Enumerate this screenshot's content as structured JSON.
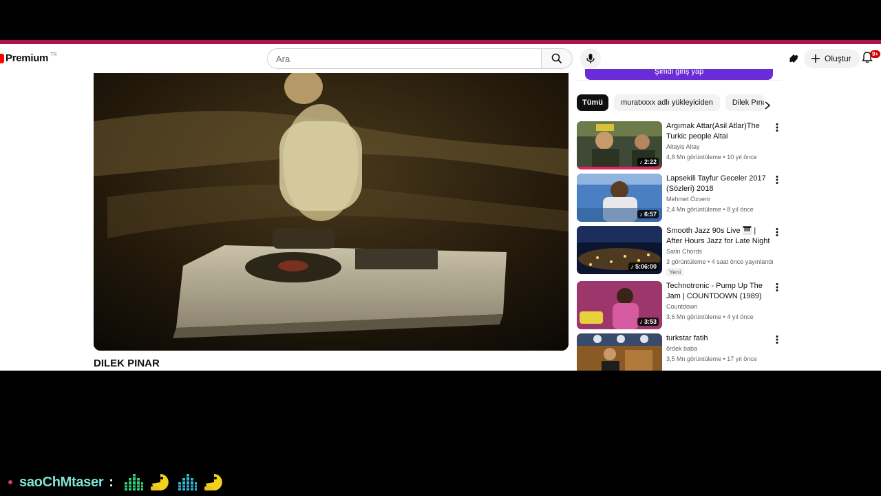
{
  "header": {
    "logo_text": "Premium",
    "logo_country": "TR",
    "search_placeholder": "Ara",
    "create_label": "Oluştur",
    "notif_count": "9+"
  },
  "video": {
    "title": "DILEK PINAR"
  },
  "sidebar": {
    "signin_button": "Şimdi giriş yap",
    "chips": [
      "Tümü",
      "muratxxxx adlı yükleyiciden",
      "Dilek Pınar"
    ],
    "recommendations": [
      {
        "title": "Argımak Attar(Asil Atlar)The Turkic people Altai",
        "channel": "Altayis Altay",
        "meta": "4,8 Mn görüntüleme • 10 yıl önce",
        "duration": "2:22",
        "is_new": false,
        "new_label": ""
      },
      {
        "title": "Lapsekili Tayfur Geceler 2017 (Sözleri) 2018",
        "channel": "Mehmet Özverir",
        "meta": "2,4 Mn görüntüleme • 8 yıl önce",
        "duration": "6:57",
        "is_new": false,
        "new_label": ""
      },
      {
        "title": "Smooth Jazz 90s Live 🎹 | After Hours Jazz for Late Night Foc...",
        "channel": "Satin Chords",
        "meta": "3 görüntüleme • 4 saat önce yayınlandı",
        "duration": "5:06:00",
        "is_new": true,
        "new_label": "Yeni"
      },
      {
        "title": "Technotronic - Pump Up The Jam | COUNTDOWN (1989)",
        "channel": "Countdown",
        "meta": "3,6 Mn görüntüleme • 4 yıl önce",
        "duration": "3:53",
        "is_new": false,
        "new_label": ""
      },
      {
        "title": "turkstar fatih",
        "channel": "ördek baba",
        "meta": "3,5 Mn görüntüleme • 17 yıl önce",
        "duration": "",
        "is_new": false,
        "new_label": ""
      }
    ]
  },
  "chat": {
    "username": "saoChMtaser",
    "separator": ":"
  },
  "colors": {
    "accent_bar": "#b0124f",
    "brand_red": "#ff0000",
    "purple_button": "#6a2cd6",
    "chat_username": "#7fe3d6"
  }
}
